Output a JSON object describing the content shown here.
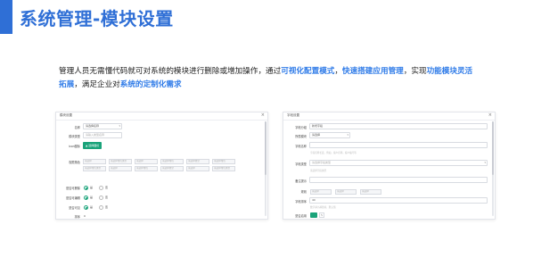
{
  "slide": {
    "title": "系统管理-模块设置",
    "desc_parts": [
      {
        "text": "管理人员无需懂代码就可对系统的模块进行删除或增加操作，通过",
        "hl": false
      },
      {
        "text": "可视化配置模式",
        "hl": true
      },
      {
        "text": "，",
        "hl": false
      },
      {
        "text": "快速搭建应用管理",
        "hl": true
      },
      {
        "text": "，实现",
        "hl": false
      },
      {
        "text": "功能模块灵活拓展",
        "hl": true
      },
      {
        "text": "，满足企业对",
        "hl": false
      },
      {
        "text": "系统的定制化需求",
        "hl": true
      }
    ]
  },
  "left_panel": {
    "title": "模块设置",
    "close": "×",
    "rows": {
      "name_label": "名称",
      "name_value": "请选择名称",
      "type_label": "模块类型",
      "type_placeholder": "请输入类型名称",
      "icon_label": "icon图标",
      "icon_button": "选择图标",
      "perm_label": "权限角色",
      "perm_chips": [
        "请选择",
        "请选择角色类型",
        "请选择",
        "请选择角色",
        "请选择类型",
        "请选择角色",
        "请选择角色类型",
        "请选择",
        "请选择角色",
        "请选择类型",
        "请选择",
        "请选择角色类型"
      ],
      "radio_rows": [
        {
          "label": "是否可删除",
          "yes": "是",
          "no": "否"
        },
        {
          "label": "是否可编辑",
          "yes": "是",
          "no": "否"
        },
        {
          "label": "是否可见",
          "yes": "是",
          "no": "否"
        }
      ],
      "sort_label": "排序",
      "sort_value": "0"
    }
  },
  "right_panel": {
    "title": "字段设置",
    "close": "×",
    "rows": {
      "group_label": "字段分组",
      "group_value": "新增字段",
      "module_label": "所属模块",
      "module_value": "请选择",
      "name_label": "字段名称",
      "name_placeholder": "",
      "name_hint": "字段名称长度，例如，客户名称，客户编号等",
      "type_label": "字段类型",
      "type_value": "请选择字段类型",
      "type_hint": "请选择字段类型",
      "note_label": "备注提示",
      "note_placeholder": "",
      "rule_label": "规则",
      "rule_chips": [
        "请选择",
        "请选择",
        "请选择"
      ],
      "sort_label": "字段排序",
      "sort_value": "40",
      "sort_hint": "数字越小越靠前，默认值",
      "enable_label": "是否启用"
    }
  }
}
